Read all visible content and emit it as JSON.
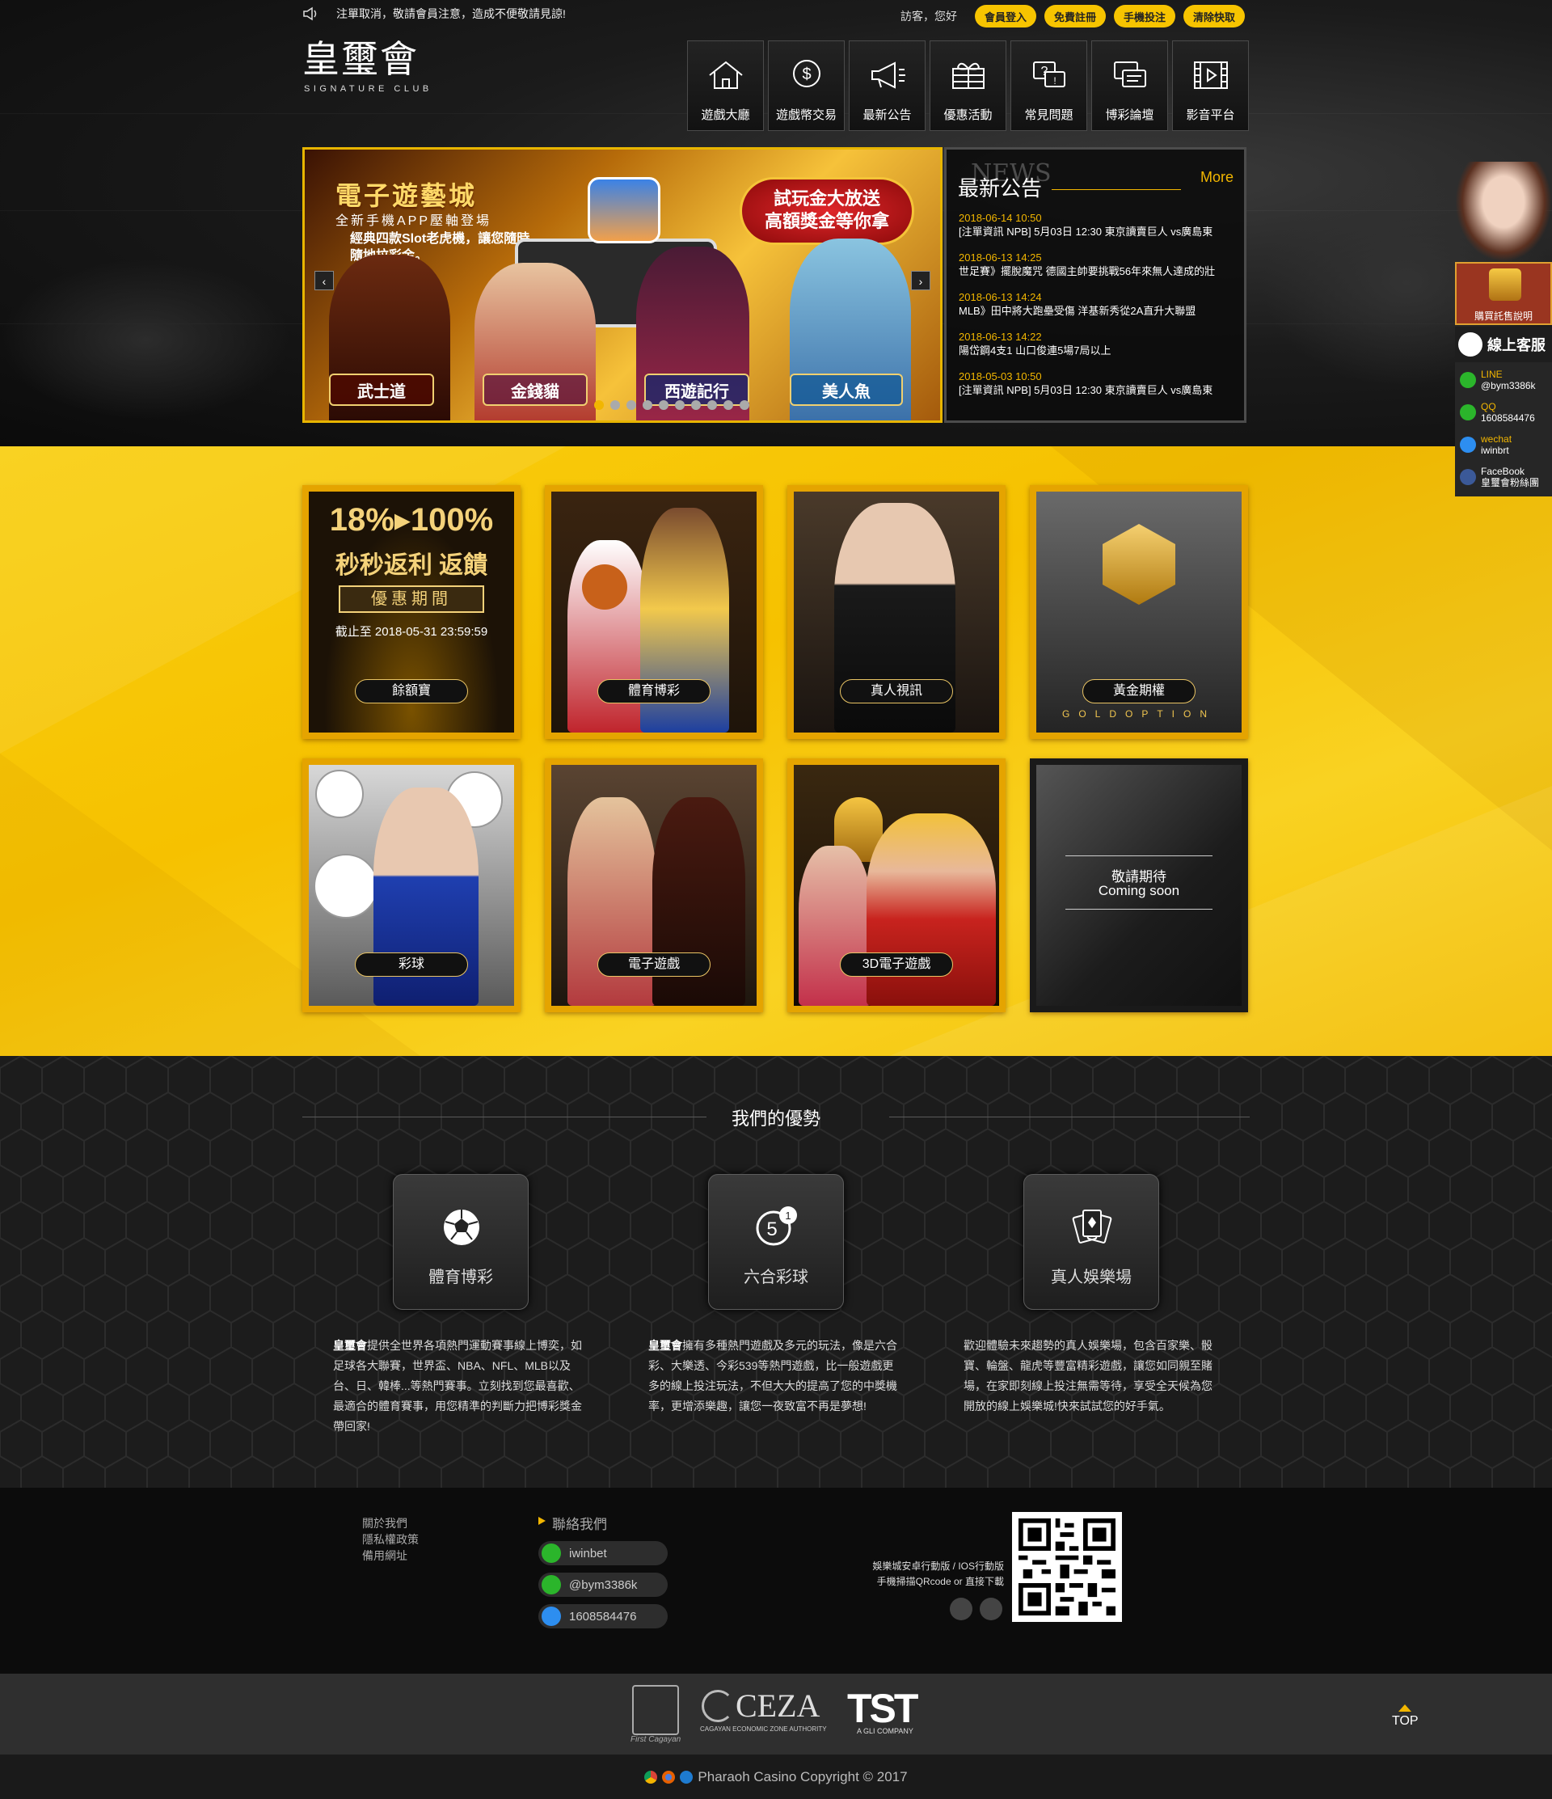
{
  "notice": {
    "text": "注單取消，敬請會員注意，造成不便敬請見諒!"
  },
  "header": {
    "greeting": "訪客，您好",
    "buttons": [
      "會員登入",
      "免費註冊",
      "手機投注",
      "清除快取"
    ],
    "logo": {
      "title": "皇璽會",
      "subtitle": "SIGNATURE CLUB"
    },
    "nav": [
      {
        "label": "遊戲大廳",
        "icon": "home-icon"
      },
      {
        "label": "遊戲幣交易",
        "icon": "dollar-coin-icon"
      },
      {
        "label": "最新公告",
        "icon": "megaphone-icon"
      },
      {
        "label": "優惠活動",
        "icon": "gift-icon"
      },
      {
        "label": "常見問題",
        "icon": "question-chat-icon"
      },
      {
        "label": "博彩論壇",
        "icon": "forum-icon"
      },
      {
        "label": "影音平台",
        "icon": "film-icon"
      }
    ]
  },
  "banner": {
    "title": "電子遊藝城",
    "subtitle": "全新手機APP壓軸登場",
    "desc": "經典四款Slot老虎機，讓您隨時隨地拉彩金。",
    "promo": [
      "試玩金大放送",
      "高額獎金等你拿"
    ],
    "games": [
      "武士道",
      "金錢貓",
      "西遊記行",
      "美人魚"
    ],
    "prev": "‹",
    "next": "›",
    "dots": 10
  },
  "news": {
    "bg_text": "NEWS",
    "title": "最新公告",
    "more": "More",
    "items": [
      {
        "date": "2018-06-14 10:50",
        "text": "[注單資訊 NPB] 5月03日 12:30 東京讀賣巨人 vs廣島東"
      },
      {
        "date": "2018-06-13 14:25",
        "text": "世足賽》擺脫魔咒 德國主帥要挑戰56年來無人達成的壯"
      },
      {
        "date": "2018-06-13 14:24",
        "text": "MLB》田中將大跑壘受傷 洋基新秀從2A直升大聯盟"
      },
      {
        "date": "2018-06-13 14:22",
        "text": "陽岱鋼4支1 山口俊連5場7局以上"
      },
      {
        "date": "2018-05-03 10:50",
        "text": "[注單資訊 NPB] 5月03日 12:30 東京讀賣巨人 vs廣島東"
      }
    ]
  },
  "side": {
    "purchase": "購買託售說明",
    "service": "線上客服",
    "items": [
      {
        "name": "LINE",
        "value": "@bym3386k",
        "color": "#2bb52b"
      },
      {
        "name": "QQ",
        "value": "1608584476",
        "color": "#2bb52b"
      },
      {
        "name": "wechat",
        "value": "iwinbrt",
        "color": "#2d8ef0"
      },
      {
        "name": "FaceBook",
        "value": "皇璽會粉絲團",
        "color": "#3b5998"
      }
    ]
  },
  "tiles": {
    "promo_rate": "18%▸100%",
    "promo_title": "秒秒返利 返饋",
    "promo_period": "優惠期間",
    "promo_deadline": "截止至 2018-05-31 23:59:59",
    "gold_caption": "GOLDOPTION",
    "soon_cn": "敬請期待",
    "soon_en": "Coming soon",
    "labels": [
      "餘額寶",
      "體育博彩",
      "真人視訊",
      "黃金期權",
      "彩球",
      "電子遊戲",
      "3D電子遊戲"
    ]
  },
  "advantages": {
    "title": "我們的優勢",
    "cards": [
      {
        "label": "體育博彩",
        "icon": "soccer-ball-icon",
        "brand": "皇璽會",
        "text": "提供全世界各項熱門運動賽事線上博奕，如足球各大聯賽，世界盃、NBA、NFL、MLB以及台、日、韓棒...等熱門賽事。立刻找到您最喜歡、最適合的體育賽事，用您精準的判斷力把博彩獎金帶回家!"
      },
      {
        "label": "六合彩球",
        "icon": "lottery-ball-icon",
        "brand": "皇璽會",
        "text": "擁有多種熱門遊戲及多元的玩法，像是六合彩、大樂透、今彩539等熱門遊戲，比一般遊戲更多的線上投注玩法，不但大大的提高了您的中獎機率，更增添樂趣，讓您一夜致富不再是夢想!"
      },
      {
        "label": "真人娛樂場",
        "icon": "playing-cards-icon",
        "brand": "",
        "text": "歡迎體驗未來趨勢的真人娛樂場，包含百家樂、骰寶、輪盤、龍虎等豐富精彩遊戲，讓您如同親至賭場，在家即刻線上投注無需等待，享受全天候為您開放的線上娛樂城!快來試試您的好手氣。"
      }
    ]
  },
  "footer": {
    "links": [
      "關於我們",
      "隱私權政策",
      "備用網址"
    ],
    "contact_title": "聯絡我們",
    "contacts": [
      {
        "value": "iwinbet",
        "icon": "wechat-icon",
        "color": "#2bb52b"
      },
      {
        "value": "@bym3386k",
        "icon": "line-icon",
        "color": "#2bb52b"
      },
      {
        "value": "1608584476",
        "icon": "qq-icon",
        "color": "#2d8ef0"
      }
    ],
    "app_text": [
      "娛樂城安卓行動版 / IOS行動版",
      "手機掃描QRcode or 直接下載"
    ],
    "partners": [
      "First Cagayan",
      "CEZA",
      "CAGAYAN ECONOMIC ZONE AUTHORITY",
      "TST",
      "A GLI COMPANY"
    ],
    "top": "TOP",
    "copyright": "Pharaoh Casino Copyright © 2017"
  }
}
